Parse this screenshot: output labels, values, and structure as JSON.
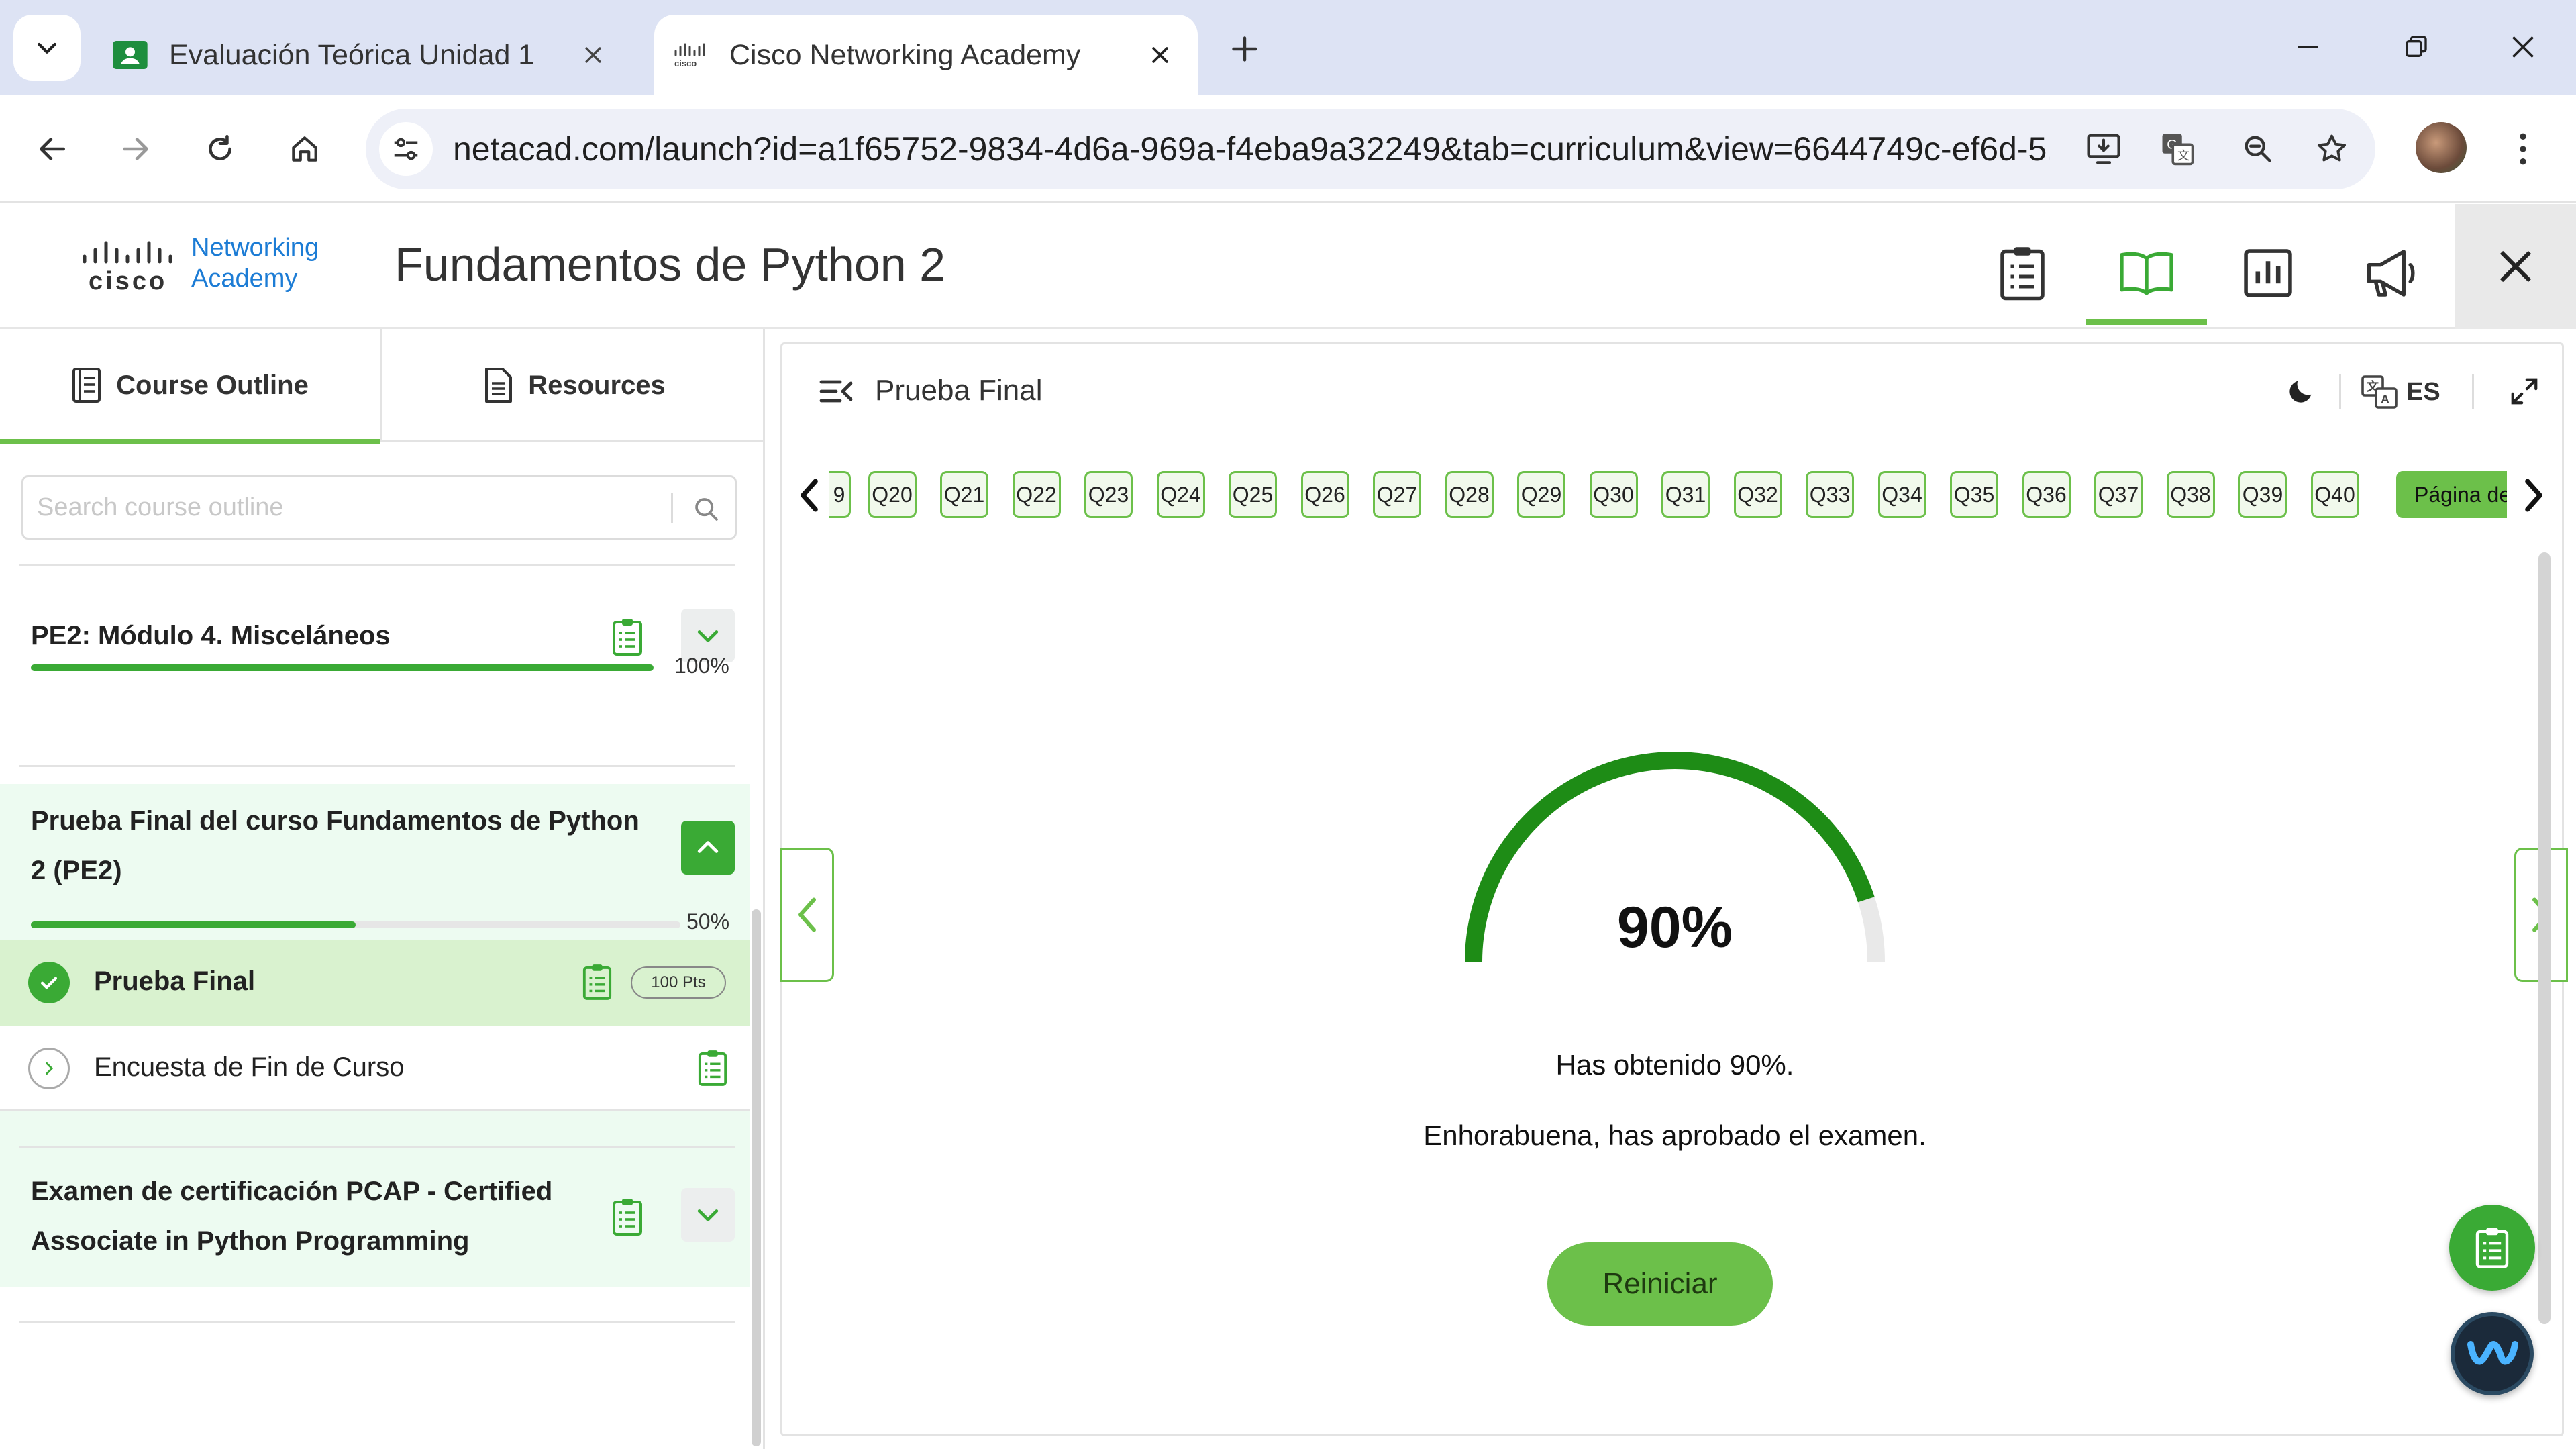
{
  "browser": {
    "tabs": [
      {
        "title": "Evaluación Teórica Unidad 1",
        "active": false
      },
      {
        "title": "Cisco Networking Academy",
        "active": true
      }
    ],
    "url": "netacad.com/launch?id=a1f65752-9834-4d6a-969a-f4eba9a32249&tab=curriculum&view=6644749c-ef6d-5..."
  },
  "app": {
    "logo_line1": "Networking",
    "logo_line2": "Academy",
    "logo_cisco": "cisco",
    "course_title": "Fundamentos de Python 2"
  },
  "sidebar": {
    "tabs": [
      "Course Outline",
      "Resources"
    ],
    "search_placeholder": "Search course outline",
    "modules": [
      {
        "title": "PE2: Módulo 4. Misceláneos",
        "progress": 100,
        "progress_label": "100%",
        "expanded": false
      },
      {
        "title_line1": "Prueba Final del curso Fundamentos de Python",
        "title_line2": "2 (PE2)",
        "progress": 50,
        "progress_label": "50%",
        "expanded": true
      },
      {
        "title_line1": "Examen de certificación PCAP - Certified",
        "title_line2": "Associate in Python Programming",
        "expanded": false
      }
    ],
    "items": [
      {
        "label": "Prueba Final",
        "badge": "100 Pts",
        "completed": true
      },
      {
        "label": "Encuesta de Fin de Curso",
        "completed": false
      }
    ]
  },
  "main": {
    "header_title": "Prueba Final",
    "lang": "ES",
    "questions": [
      "9",
      "Q20",
      "Q21",
      "Q22",
      "Q23",
      "Q24",
      "Q25",
      "Q26",
      "Q27",
      "Q28",
      "Q29",
      "Q30",
      "Q31",
      "Q32",
      "Q33",
      "Q34",
      "Q35",
      "Q36",
      "Q37",
      "Q38",
      "Q39",
      "Q40"
    ],
    "final_page_label": "Página de r",
    "score_value": 90,
    "score_label": "90%",
    "message1": "Has obtenido 90%.",
    "message2": "Enhorabuena, has aprobado el examen.",
    "retry_label": "Reiniciar"
  },
  "colors": {
    "accent_green": "#6cc04a",
    "dark_green": "#1e8c16",
    "cisco_blue": "#1c7cd5"
  }
}
